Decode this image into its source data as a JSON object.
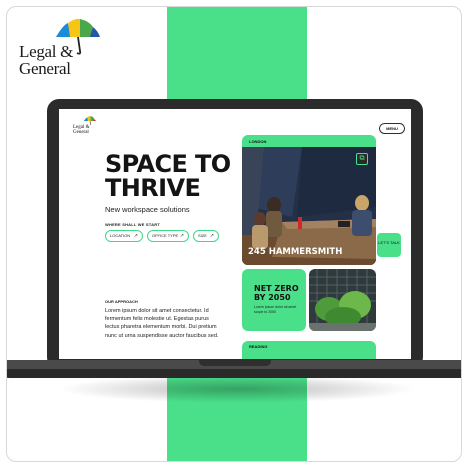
{
  "colors": {
    "brand_green": "#4ae08a",
    "laptop_body": "#2b2b2b",
    "text_dark": "#141414"
  },
  "brand": {
    "line1": "Legal &",
    "line2": "General",
    "icon": "umbrella-logo-icon"
  },
  "website": {
    "logo_line1": "Legal &",
    "logo_line2": "General",
    "menu_label": "MENU",
    "hero": {
      "title": "SPACE TO THRIVE",
      "subtitle": "New workspace solutions"
    },
    "where_label": "WHERE SHALL WE START",
    "filters": [
      {
        "label": "LOCATION",
        "icon": "arrow-up-right-icon"
      },
      {
        "label": "OFFICE TYPE",
        "icon": "arrow-up-right-icon"
      },
      {
        "label": "SIZE",
        "icon": "arrow-up-right-icon"
      }
    ],
    "approach": {
      "heading": "OUR APPROACH",
      "body": "Lorem ipsum dolor sit amet consectetur. Id fermentum felis molestie ut. Egestas purus lectus pharetra elementum morbi. Dui pretium nunc ut urna suspendisse auctor faucibus sed."
    },
    "london_card": {
      "tag": "LONDON",
      "name": "245 HAMMERSMITH",
      "icon": "expand-icon"
    },
    "lets_talk": "LET'S TALK",
    "net_zero": {
      "title": "NET ZERO BY 2050",
      "subtitle": "Lorem ipsum dolor sit amet scope to 2050"
    },
    "reading_card": {
      "tag": "READING"
    }
  }
}
